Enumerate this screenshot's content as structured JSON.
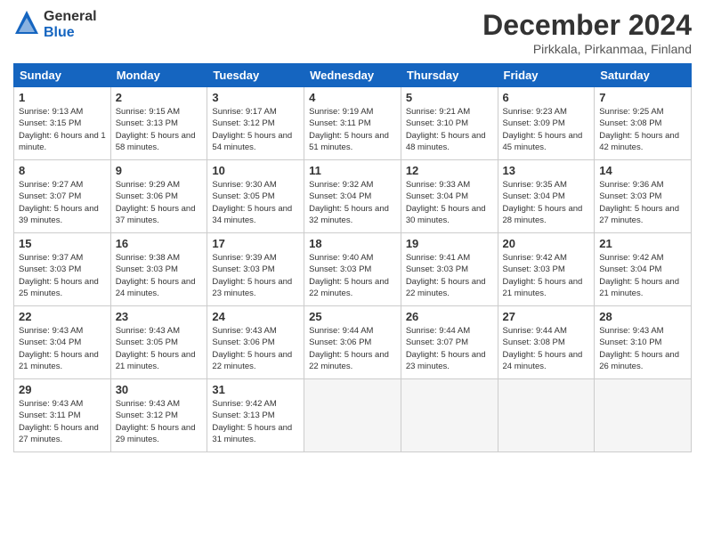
{
  "header": {
    "logo_general": "General",
    "logo_blue": "Blue",
    "month": "December 2024",
    "location": "Pirkkala, Pirkanmaa, Finland"
  },
  "days_of_week": [
    "Sunday",
    "Monday",
    "Tuesday",
    "Wednesday",
    "Thursday",
    "Friday",
    "Saturday"
  ],
  "weeks": [
    [
      {
        "day": "1",
        "sunrise": "9:13 AM",
        "sunset": "3:15 PM",
        "daylight": "6 hours and 1 minute."
      },
      {
        "day": "2",
        "sunrise": "9:15 AM",
        "sunset": "3:13 PM",
        "daylight": "5 hours and 58 minutes."
      },
      {
        "day": "3",
        "sunrise": "9:17 AM",
        "sunset": "3:12 PM",
        "daylight": "5 hours and 54 minutes."
      },
      {
        "day": "4",
        "sunrise": "9:19 AM",
        "sunset": "3:11 PM",
        "daylight": "5 hours and 51 minutes."
      },
      {
        "day": "5",
        "sunrise": "9:21 AM",
        "sunset": "3:10 PM",
        "daylight": "5 hours and 48 minutes."
      },
      {
        "day": "6",
        "sunrise": "9:23 AM",
        "sunset": "3:09 PM",
        "daylight": "5 hours and 45 minutes."
      },
      {
        "day": "7",
        "sunrise": "9:25 AM",
        "sunset": "3:08 PM",
        "daylight": "5 hours and 42 minutes."
      }
    ],
    [
      {
        "day": "8",
        "sunrise": "9:27 AM",
        "sunset": "3:07 PM",
        "daylight": "5 hours and 39 minutes."
      },
      {
        "day": "9",
        "sunrise": "9:29 AM",
        "sunset": "3:06 PM",
        "daylight": "5 hours and 37 minutes."
      },
      {
        "day": "10",
        "sunrise": "9:30 AM",
        "sunset": "3:05 PM",
        "daylight": "5 hours and 34 minutes."
      },
      {
        "day": "11",
        "sunrise": "9:32 AM",
        "sunset": "3:04 PM",
        "daylight": "5 hours and 32 minutes."
      },
      {
        "day": "12",
        "sunrise": "9:33 AM",
        "sunset": "3:04 PM",
        "daylight": "5 hours and 30 minutes."
      },
      {
        "day": "13",
        "sunrise": "9:35 AM",
        "sunset": "3:04 PM",
        "daylight": "5 hours and 28 minutes."
      },
      {
        "day": "14",
        "sunrise": "9:36 AM",
        "sunset": "3:03 PM",
        "daylight": "5 hours and 27 minutes."
      }
    ],
    [
      {
        "day": "15",
        "sunrise": "9:37 AM",
        "sunset": "3:03 PM",
        "daylight": "5 hours and 25 minutes."
      },
      {
        "day": "16",
        "sunrise": "9:38 AM",
        "sunset": "3:03 PM",
        "daylight": "5 hours and 24 minutes."
      },
      {
        "day": "17",
        "sunrise": "9:39 AM",
        "sunset": "3:03 PM",
        "daylight": "5 hours and 23 minutes."
      },
      {
        "day": "18",
        "sunrise": "9:40 AM",
        "sunset": "3:03 PM",
        "daylight": "5 hours and 22 minutes."
      },
      {
        "day": "19",
        "sunrise": "9:41 AM",
        "sunset": "3:03 PM",
        "daylight": "5 hours and 22 minutes."
      },
      {
        "day": "20",
        "sunrise": "9:42 AM",
        "sunset": "3:03 PM",
        "daylight": "5 hours and 21 minutes."
      },
      {
        "day": "21",
        "sunrise": "9:42 AM",
        "sunset": "3:04 PM",
        "daylight": "5 hours and 21 minutes."
      }
    ],
    [
      {
        "day": "22",
        "sunrise": "9:43 AM",
        "sunset": "3:04 PM",
        "daylight": "5 hours and 21 minutes."
      },
      {
        "day": "23",
        "sunrise": "9:43 AM",
        "sunset": "3:05 PM",
        "daylight": "5 hours and 21 minutes."
      },
      {
        "day": "24",
        "sunrise": "9:43 AM",
        "sunset": "3:06 PM",
        "daylight": "5 hours and 22 minutes."
      },
      {
        "day": "25",
        "sunrise": "9:44 AM",
        "sunset": "3:06 PM",
        "daylight": "5 hours and 22 minutes."
      },
      {
        "day": "26",
        "sunrise": "9:44 AM",
        "sunset": "3:07 PM",
        "daylight": "5 hours and 23 minutes."
      },
      {
        "day": "27",
        "sunrise": "9:44 AM",
        "sunset": "3:08 PM",
        "daylight": "5 hours and 24 minutes."
      },
      {
        "day": "28",
        "sunrise": "9:43 AM",
        "sunset": "3:10 PM",
        "daylight": "5 hours and 26 minutes."
      }
    ],
    [
      {
        "day": "29",
        "sunrise": "9:43 AM",
        "sunset": "3:11 PM",
        "daylight": "5 hours and 27 minutes."
      },
      {
        "day": "30",
        "sunrise": "9:43 AM",
        "sunset": "3:12 PM",
        "daylight": "5 hours and 29 minutes."
      },
      {
        "day": "31",
        "sunrise": "9:42 AM",
        "sunset": "3:13 PM",
        "daylight": "5 hours and 31 minutes."
      },
      null,
      null,
      null,
      null
    ]
  ]
}
